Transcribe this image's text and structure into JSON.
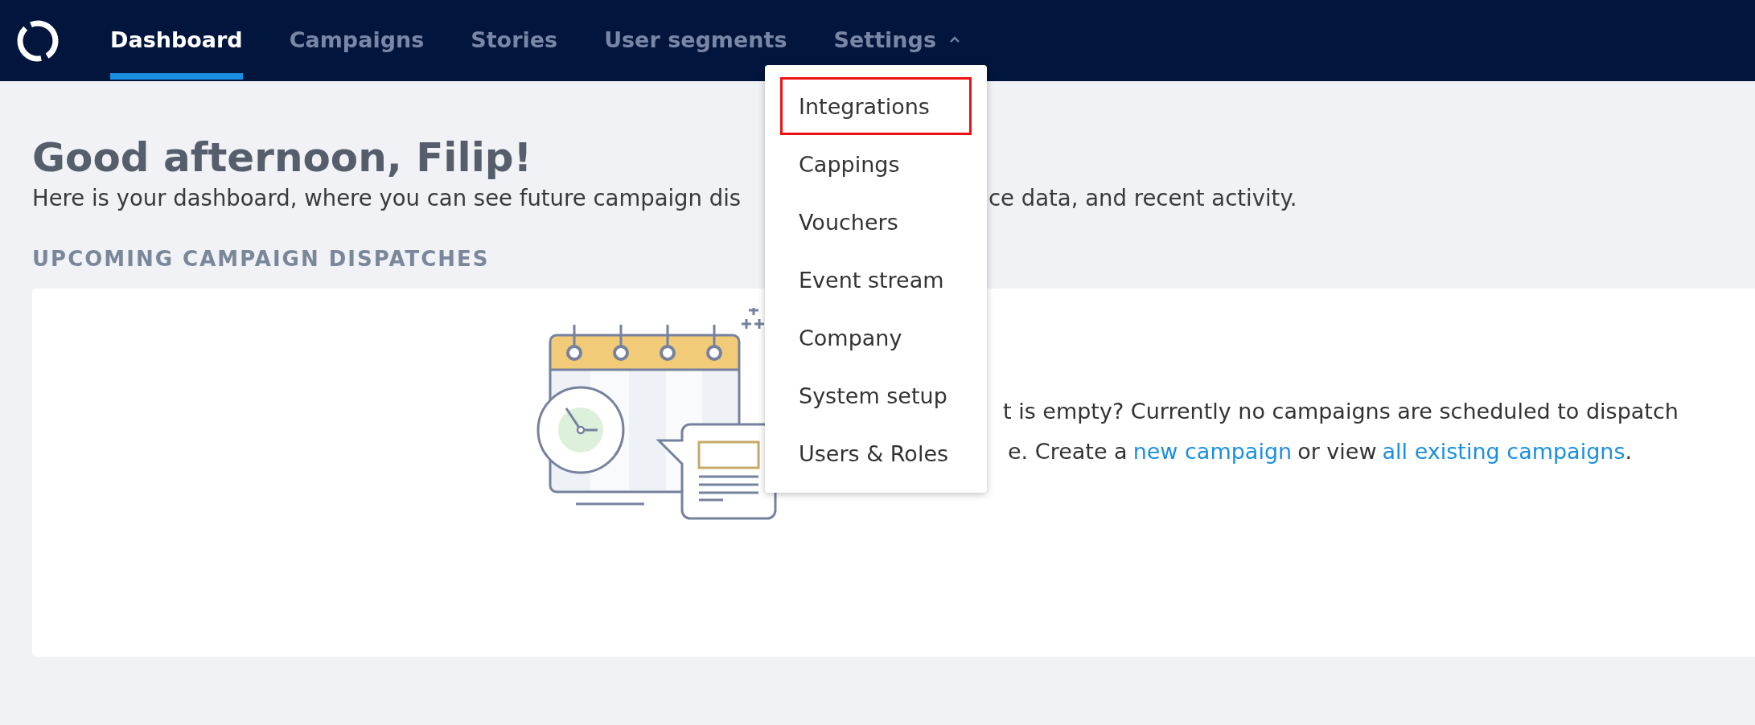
{
  "nav": {
    "items": [
      {
        "label": "Dashboard",
        "selected": true
      },
      {
        "label": "Campaigns",
        "selected": false
      },
      {
        "label": "Stories",
        "selected": false
      },
      {
        "label": "User segments",
        "selected": false
      },
      {
        "label": "Settings",
        "selected": false,
        "expanded": true
      }
    ]
  },
  "settings_menu": [
    {
      "label": "Integrations",
      "highlighted": true
    },
    {
      "label": "Cappings",
      "highlighted": false
    },
    {
      "label": "Vouchers",
      "highlighted": false
    },
    {
      "label": "Event stream",
      "highlighted": false
    },
    {
      "label": "Company",
      "highlighted": false
    },
    {
      "label": "System setup",
      "highlighted": false
    },
    {
      "label": "Users & Roles",
      "highlighted": false
    }
  ],
  "greeting": "Good afternoon, Filip!",
  "intro": [
    "Here is your dashboard, where you can see future campaign dis",
    "ce data, and recent activity."
  ],
  "section_title": "UPCOMING CAMPAIGN DISPATCHES",
  "empty_state": {
    "line_1": "t is empty? Currently no campaigns are scheduled to dispatch",
    "line_2": [
      {
        "kind": "text",
        "text": "e. Create a"
      },
      {
        "kind": "link",
        "text": "new campaign"
      },
      {
        "kind": "text",
        "text": "or view"
      },
      {
        "kind": "link",
        "text": "all existing campaigns"
      },
      {
        "kind": "text",
        "text": "."
      }
    ]
  }
}
